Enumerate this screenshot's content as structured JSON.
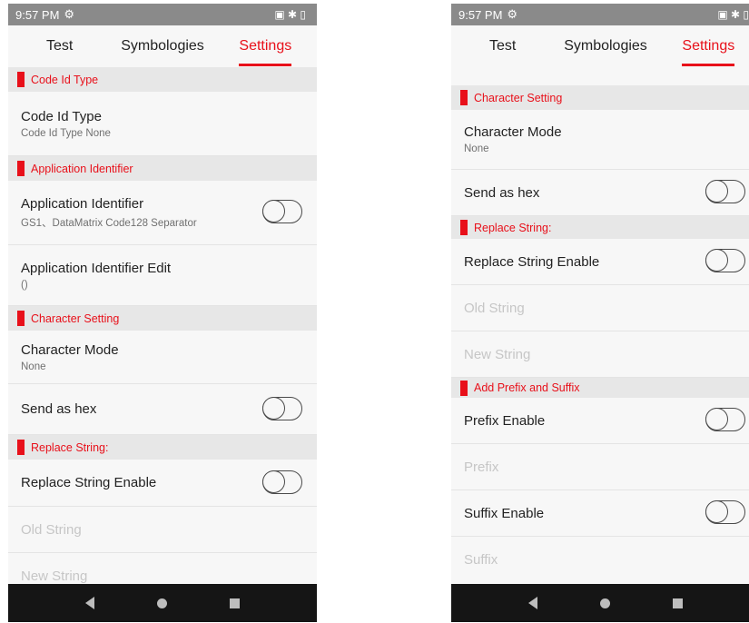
{
  "status": {
    "time": "9:57 PM",
    "settings_icon": "⚙",
    "right_icons": "▣ ✱ ▯"
  },
  "tabs": [
    "Test",
    "Symbologies",
    "Settings"
  ],
  "active_tab": "Settings",
  "accent_color": "#e8101a",
  "left": {
    "headers": {
      "code_id": "Code Id Type",
      "app_id": "Application Identifier",
      "char": "Character Setting",
      "replace": "Replace String:"
    },
    "rows": {
      "code_id_title": "Code Id Type",
      "code_id_sub": "Code Id Type None",
      "app_id_title": "Application Identifier",
      "app_id_sub": "GS1、DataMatrix Code128 Separator",
      "app_id_edit_title": "Application Identifier Edit",
      "app_id_edit_sub": "()",
      "char_mode_title": "Character Mode",
      "char_mode_sub": "None",
      "send_hex": "Send as hex",
      "replace_enable": "Replace String Enable",
      "old_string": "Old String",
      "new_string": "New String"
    }
  },
  "right": {
    "headers": {
      "char": "Character Setting",
      "replace": "Replace String:",
      "prefix_suffix": "Add Prefix and Suffix"
    },
    "rows": {
      "char_mode_title": "Character Mode",
      "char_mode_sub": "None",
      "send_hex": "Send as hex",
      "replace_enable": "Replace String Enable",
      "old_string": "Old String",
      "new_string": "New String",
      "prefix_enable": "Prefix Enable",
      "prefix": "Prefix",
      "suffix_enable": "Suffix Enable",
      "suffix": "Suffix"
    }
  },
  "toggles": {
    "app_id": false,
    "send_hex": false,
    "replace_enable": false,
    "prefix_enable": false,
    "suffix_enable": false
  }
}
